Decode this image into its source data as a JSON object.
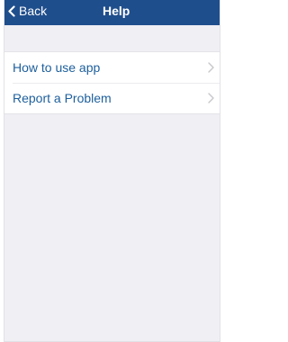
{
  "navbar": {
    "back_label": "Back",
    "back_icon": "chevron-left-icon",
    "title": "Help",
    "background_color": "#1f4e8c"
  },
  "menu": {
    "items": [
      {
        "label": "How to use app",
        "icon": "chevron-right-icon"
      },
      {
        "label": "Report a Problem",
        "icon": "chevron-right-icon"
      }
    ]
  },
  "colors": {
    "accent": "#1d5f9c",
    "background": "#efeff4"
  }
}
